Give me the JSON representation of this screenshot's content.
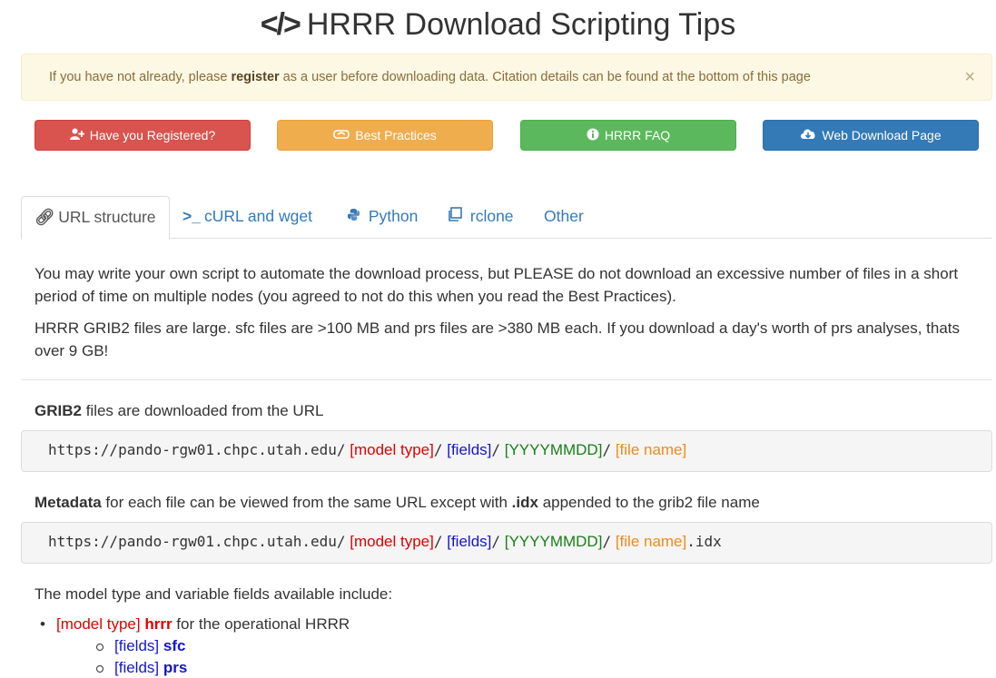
{
  "title": {
    "icon": "</>",
    "text": "HRRR Download Scripting Tips"
  },
  "alert": {
    "pre": "If you have not already, please ",
    "link": "register",
    "post": " as a user before downloading data. Citation details can be found at the bottom of this page",
    "close": "×"
  },
  "buttons": [
    {
      "label": "Have you Registered?",
      "icon": "user-plus-icon",
      "color": "#d9534f"
    },
    {
      "label": "Best Practices",
      "icon": "handshake-icon",
      "color": "#f0ad4e"
    },
    {
      "label": "HRRR FAQ",
      "icon": "info-circle-icon",
      "color": "#5cb85c"
    },
    {
      "label": "Web Download Page",
      "icon": "cloud-download-icon",
      "color": "#337ab7"
    }
  ],
  "tabs": [
    {
      "label": "URL structure",
      "icon": "link-icon",
      "active": true
    },
    {
      "label": "cURL and wget",
      "icon": "terminal-icon",
      "active": false
    },
    {
      "label": "Python",
      "icon": "python-icon",
      "active": false
    },
    {
      "label": "rclone",
      "icon": "clone-icon",
      "active": false
    },
    {
      "label": "Other",
      "icon": "",
      "active": false
    }
  ],
  "intro": {
    "p1": "You may write your own script to automate the download process, but PLEASE do not download an excessive number of files in a short period of time on multiple nodes (you agreed to not do this when you read the Best Practices).",
    "p2": "HRRR GRIB2 files are large. sfc files are >100 MB and prs files are >380 MB each. If you download a day's worth of prs analyses, thats over 9 GB!"
  },
  "grib2": {
    "bold": "GRIB2",
    "rest": " files are downloaded from the URL",
    "base": "https://pando-rgw01.chpc.utah.edu/",
    "model_type": "[model type]",
    "fields": "[fields]",
    "date": "[YYYYMMDD]",
    "file_name": "[file name]",
    "slash": "/"
  },
  "metadata": {
    "bold": "Metadata",
    "mid": " for each file can be viewed from the same URL except with ",
    "idx_bold": ".idx",
    "end": " appended to the grib2 file name",
    "suffix": ".idx"
  },
  "models_intro": "The model type and variable fields available include:",
  "models": [
    {
      "tag": "[model type]",
      "name": "hrrr",
      "desc": " for the operational HRRR",
      "fields": [
        {
          "tag": "[fields]",
          "name": "sfc"
        },
        {
          "tag": "[fields]",
          "name": "prs"
        }
      ]
    }
  ]
}
